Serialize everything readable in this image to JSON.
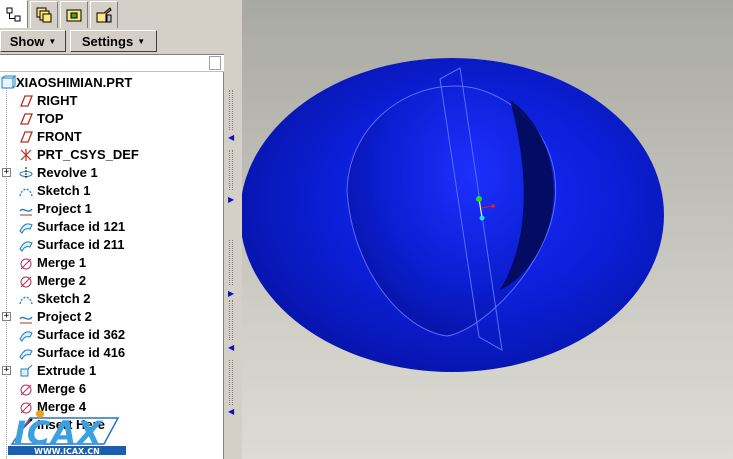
{
  "tabs": [
    {
      "icon": "model-tree-icon",
      "active": true
    },
    {
      "icon": "layers-icon",
      "active": false
    },
    {
      "icon": "folder-browser-icon",
      "active": false
    },
    {
      "icon": "favorites-icon",
      "active": false
    }
  ],
  "toolbar": {
    "show_label": "Show",
    "settings_label": "Settings"
  },
  "tree": {
    "root": "XIAOSHIMIAN.PRT",
    "items": [
      {
        "label": "RIGHT",
        "icon": "datum-plane-icon",
        "expandable": false
      },
      {
        "label": "TOP",
        "icon": "datum-plane-icon",
        "expandable": false
      },
      {
        "label": "FRONT",
        "icon": "datum-plane-icon",
        "expandable": false
      },
      {
        "label": "PRT_CSYS_DEF",
        "icon": "coordinate-system-icon",
        "expandable": false
      },
      {
        "label": "Revolve 1",
        "icon": "revolve-icon",
        "expandable": true
      },
      {
        "label": "Sketch 1",
        "icon": "sketch-icon",
        "expandable": false
      },
      {
        "label": "Project 1",
        "icon": "project-curve-icon",
        "expandable": false
      },
      {
        "label": "Surface id 121",
        "icon": "surface-icon",
        "expandable": false
      },
      {
        "label": "Surface id 211",
        "icon": "surface-icon",
        "expandable": false
      },
      {
        "label": "Merge 1",
        "icon": "merge-icon",
        "expandable": false
      },
      {
        "label": "Merge 2",
        "icon": "merge-icon",
        "expandable": false
      },
      {
        "label": "Sketch 2",
        "icon": "sketch-icon",
        "expandable": false
      },
      {
        "label": "Project 2",
        "icon": "project-curve-icon",
        "expandable": true
      },
      {
        "label": "Surface id 362",
        "icon": "surface-icon",
        "expandable": false
      },
      {
        "label": "Surface id 416",
        "icon": "surface-icon",
        "expandable": false
      },
      {
        "label": "Extrude 1",
        "icon": "extrude-icon",
        "expandable": true
      },
      {
        "label": "Merge 6",
        "icon": "merge-icon",
        "expandable": false
      },
      {
        "label": "Merge 4",
        "icon": "merge-icon",
        "expandable": false
      },
      {
        "label": "Insert Here",
        "icon": "insert-here-icon",
        "expandable": false
      }
    ]
  },
  "watermark": {
    "logo_text": "ICAX",
    "url_text": "WWW.ICAX.CN"
  },
  "colors": {
    "surface_blue": "#0a1fd0",
    "edge_highlight": "#5b6cff",
    "csys_green": "#22dd22",
    "csys_cyan": "#22dddd",
    "csys_red": "#dd2222"
  }
}
